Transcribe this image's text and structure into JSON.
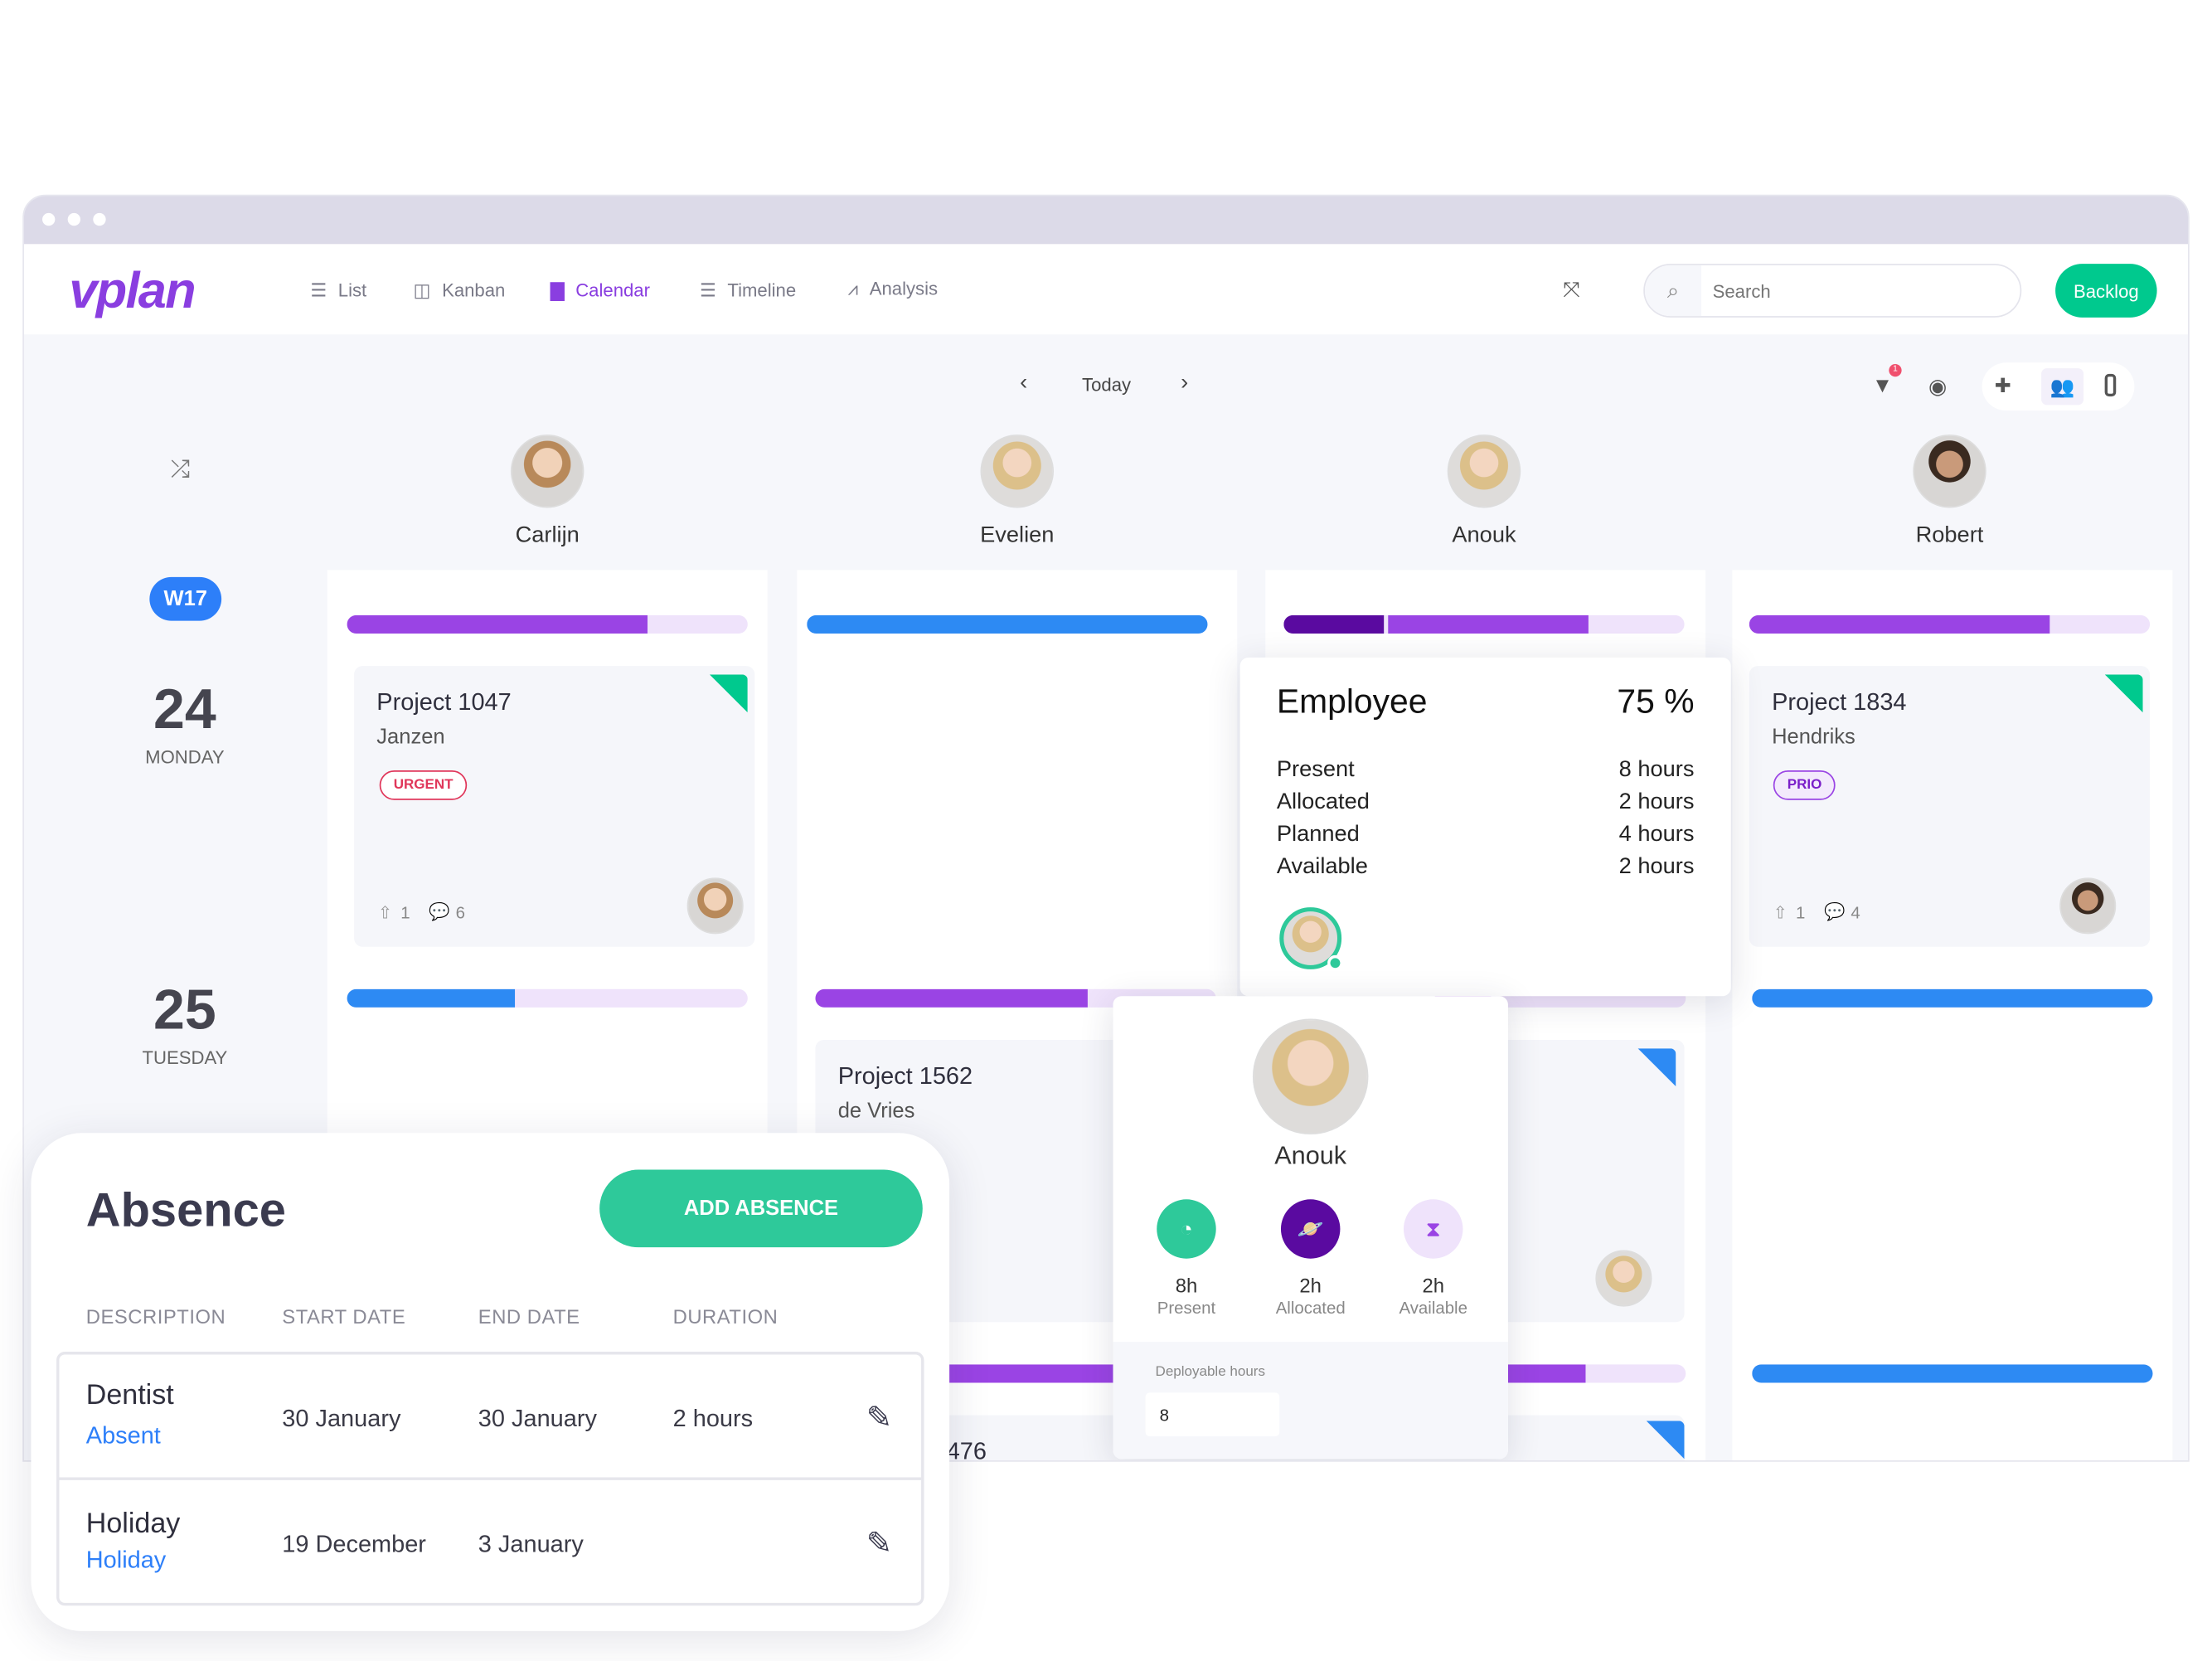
{
  "app": {
    "logo": "vplan",
    "colors": {
      "brand": "#8a3ee0",
      "green": "#00c98e",
      "blue": "#2d7ff9",
      "dark_purple": "#5a0aa0"
    }
  },
  "nav": [
    {
      "label": "List",
      "icon": "list-icon"
    },
    {
      "label": "Kanban",
      "icon": "kanban-icon"
    },
    {
      "label": "Calendar",
      "icon": "calendar-icon",
      "active": true
    },
    {
      "label": "Timeline",
      "icon": "timeline-icon"
    },
    {
      "label": "Analysis",
      "icon": "analysis-icon"
    }
  ],
  "search": {
    "placeholder": "Search",
    "value": ""
  },
  "backlog_label": "Backlog",
  "date_nav": {
    "today_label": "Today"
  },
  "filter_badge": "1",
  "week_badge": "W17",
  "days": [
    {
      "number": "24",
      "name": "MONDAY"
    },
    {
      "number": "25",
      "name": "TUESDAY"
    }
  ],
  "employees": [
    {
      "name": "Carlijn"
    },
    {
      "name": "Evelien"
    },
    {
      "name": "Anouk"
    },
    {
      "name": "Robert"
    }
  ],
  "cards": [
    {
      "title": "Project 1047",
      "client": "Janzen",
      "tag": "URGENT",
      "attachments": "1",
      "comments": "6"
    },
    {
      "title": "Project 1834",
      "client": "Hendriks",
      "tag": "PRIO",
      "attachments": "1",
      "comments": "4"
    },
    {
      "title": "Project 1562",
      "client": "de Vries"
    },
    {
      "title": "476"
    }
  ],
  "bars": {
    "carlijn_mon": 0.75,
    "evelien_mon": 1.0,
    "anouk_mon_dark": 0.25,
    "anouk_mon": 0.5,
    "robert_mon": 0.75,
    "carlijn_tue": 0.42,
    "evelien_tue": 0.68,
    "robert_tue": 1.0
  },
  "employee_popover": {
    "title": "Employee",
    "percent": "75 %",
    "rows": [
      {
        "label": "Present",
        "value": "8 hours"
      },
      {
        "label": "Allocated",
        "value": "2 hours"
      },
      {
        "label": "Planned",
        "value": "4 hours"
      },
      {
        "label": "Available",
        "value": "2 hours"
      }
    ]
  },
  "anouk_popover": {
    "name": "Anouk",
    "stats": [
      {
        "value": "8h",
        "label": "Present",
        "icon": "clock-icon"
      },
      {
        "value": "2h",
        "label": "Allocated",
        "icon": "planet-icon"
      },
      {
        "value": "2h",
        "label": "Available",
        "icon": "hourglass-icon"
      }
    ],
    "deployable_label": "Deployable hours",
    "deployable_value": "8"
  },
  "absence": {
    "title": "Absence",
    "add_label": "ADD ABSENCE",
    "columns": [
      "DESCRIPTION",
      "START DATE",
      "END DATE",
      "DURATION"
    ],
    "rows": [
      {
        "description": "Dentist",
        "type": "Absent",
        "start": "30 January",
        "end": "30 January",
        "duration": "2 hours"
      },
      {
        "description": "Holiday",
        "type": "Holiday",
        "start": "19 December",
        "end": "3 January",
        "duration": ""
      }
    ]
  }
}
